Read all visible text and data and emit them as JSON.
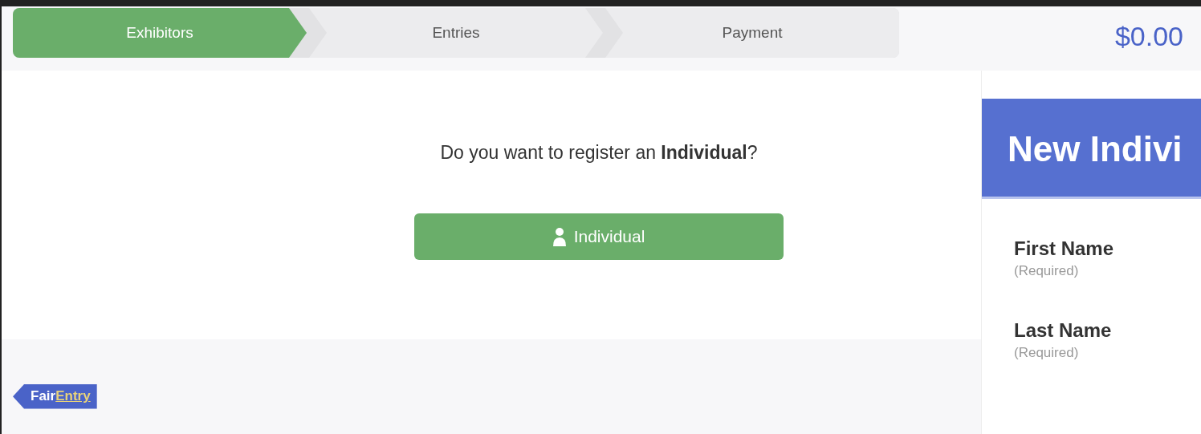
{
  "steps": [
    {
      "label": "Exhibitors",
      "selected": true
    },
    {
      "label": "Entries",
      "selected": false
    },
    {
      "label": "Payment",
      "selected": false
    }
  ],
  "total": "$0.00",
  "question": "Do you want to register an **Individual**?",
  "button": {
    "label": "Individual"
  },
  "logo": [
    "Fair",
    "Entry"
  ],
  "panel": {
    "title": "New Indivi",
    "fields": [
      {
        "label": "First Name",
        "hint": "(Required)"
      },
      {
        "label": "Last Name",
        "hint": "(Required)"
      }
    ]
  }
}
